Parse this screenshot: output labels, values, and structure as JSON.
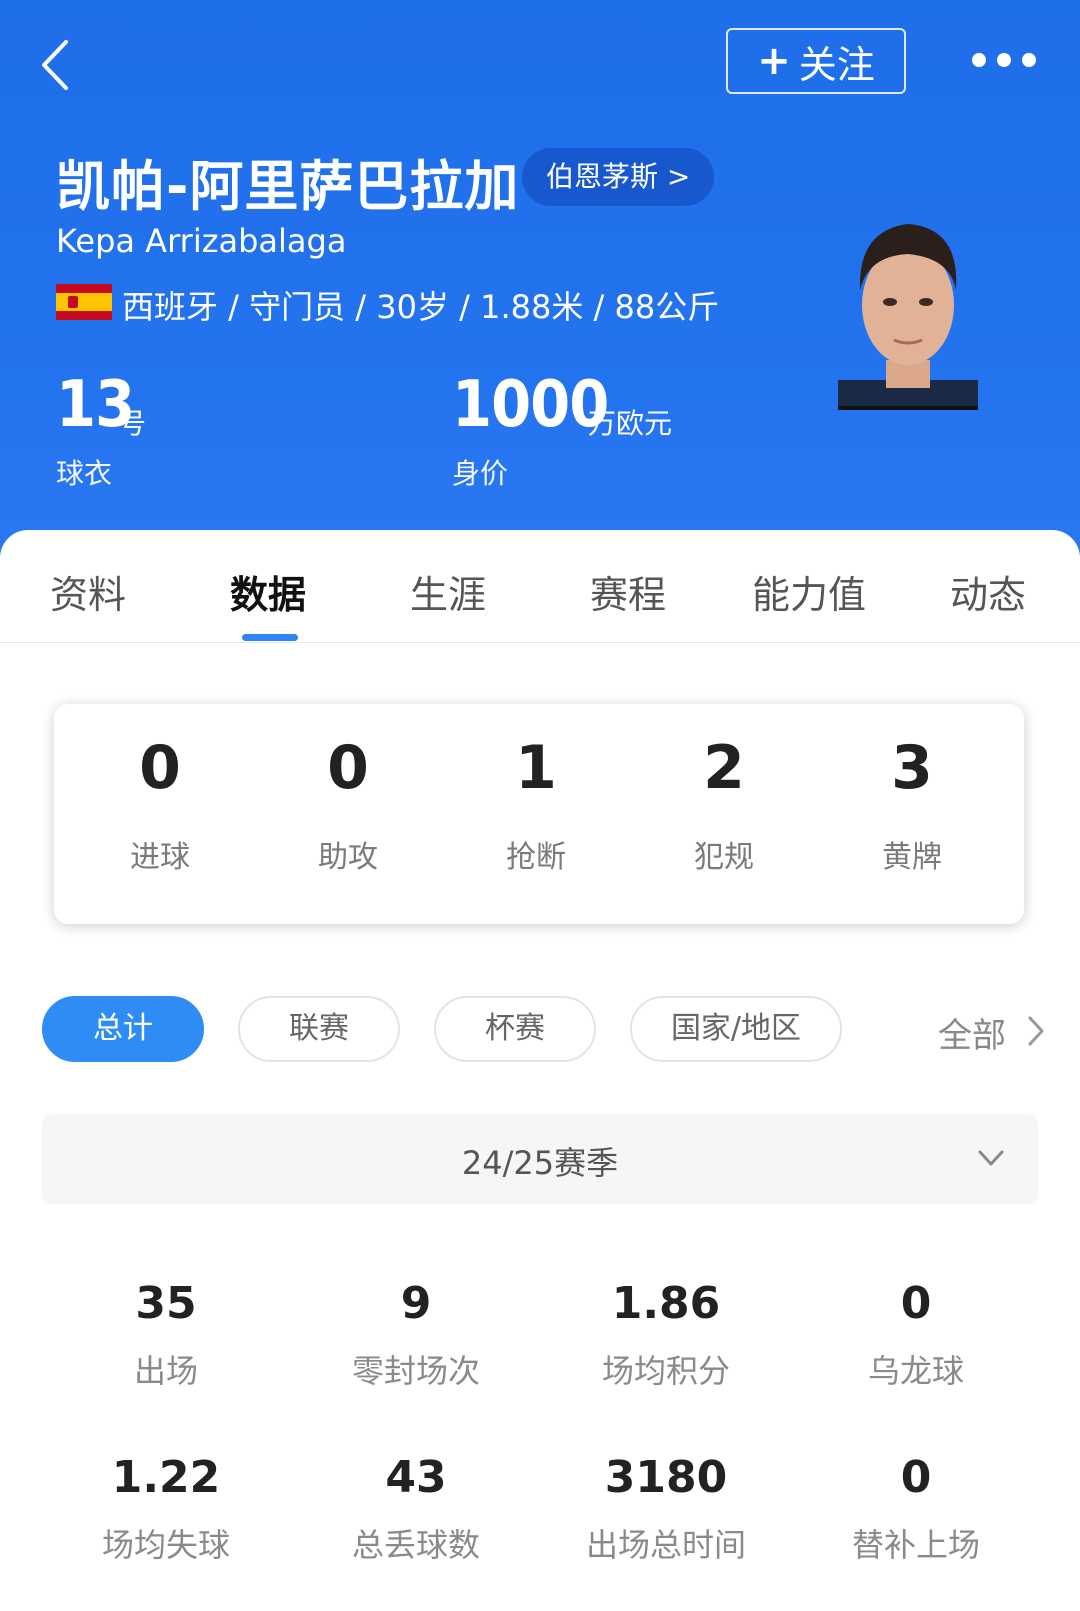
{
  "header": {
    "follow_plus": "+",
    "follow_label": "关注",
    "name_cn": "凯帕-阿里萨巴拉加",
    "club": "伯恩茅斯 >",
    "name_en": "Kepa Arrizabalaga",
    "info": "西班牙 / 守门员 / 30岁 / 1.88米 / 88公斤",
    "shirt_number": "13",
    "shirt_unit": "号",
    "shirt_label": "球衣",
    "value_number": "1000",
    "value_unit": "万欧元",
    "value_label": "身价"
  },
  "tabs": [
    {
      "label": "资料"
    },
    {
      "label": "数据"
    },
    {
      "label": "生涯"
    },
    {
      "label": "赛程"
    },
    {
      "label": "能力值"
    },
    {
      "label": "动态"
    }
  ],
  "summary": [
    {
      "value": "0",
      "label": "进球"
    },
    {
      "value": "0",
      "label": "助攻"
    },
    {
      "value": "1",
      "label": "抢断"
    },
    {
      "value": "2",
      "label": "犯规"
    },
    {
      "value": "3",
      "label": "黄牌"
    }
  ],
  "filters": [
    {
      "label": "总计"
    },
    {
      "label": "联赛"
    },
    {
      "label": "杯赛"
    },
    {
      "label": "国家/地区"
    }
  ],
  "filter_all": "全部",
  "season": "24/25赛季",
  "stats": [
    {
      "value": "35",
      "label": "出场"
    },
    {
      "value": "9",
      "label": "零封场次"
    },
    {
      "value": "1.86",
      "label": "场均积分"
    },
    {
      "value": "0",
      "label": "乌龙球"
    },
    {
      "value": "1.22",
      "label": "场均失球"
    },
    {
      "value": "43",
      "label": "总丢球数"
    },
    {
      "value": "3180",
      "label": "出场总时间"
    },
    {
      "value": "0",
      "label": "替补上场"
    }
  ],
  "colors": {
    "header_blue": "#2372ee",
    "accent": "#2f8cf5"
  }
}
